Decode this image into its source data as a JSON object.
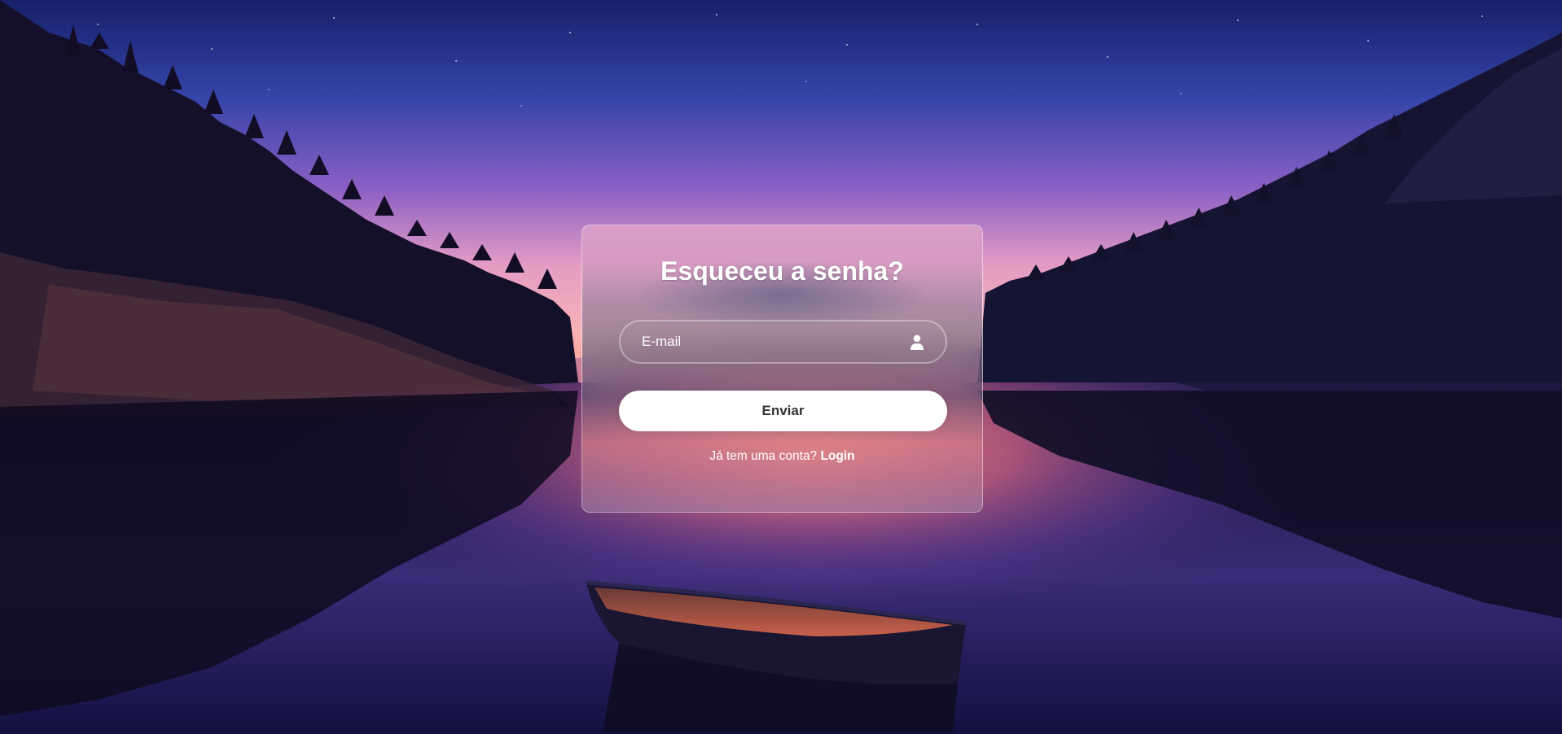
{
  "page": {
    "title": "Esqueceu a senha?"
  },
  "form": {
    "email_placeholder": "E-mail",
    "email_value": "",
    "email_icon": "user-icon",
    "submit_label": "Enviar"
  },
  "footer": {
    "prompt": "Já tem uma conta?",
    "login_label": "Login"
  },
  "colors": {
    "card_border": "#ffffff",
    "button_bg": "#ffffff",
    "button_text": "#333333",
    "text": "#ffffff",
    "sky_top": "#1c2470",
    "sky_horizon": "#f0a8b0",
    "water": "#150f2a"
  }
}
